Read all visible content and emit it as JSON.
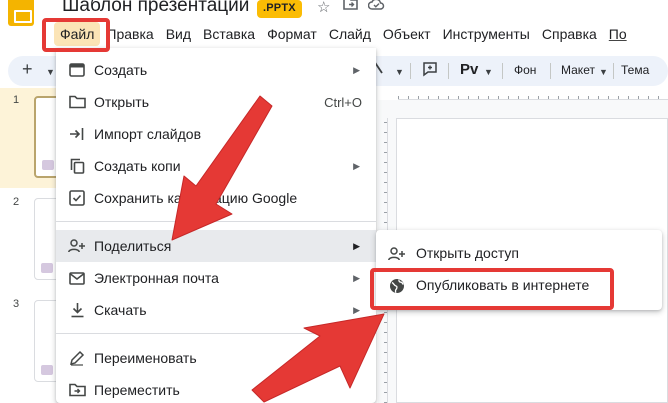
{
  "title_bar": {
    "doc_title": "Шаблон презентации",
    "badge": ".PPTX",
    "star_icon": "star-icon",
    "move_icon": "move-to-folder-icon",
    "cloud_icon": "cloud-status-icon"
  },
  "menu_bar": {
    "items": [
      "Файл",
      "Правка",
      "Вид",
      "Вставка",
      "Формат",
      "Слайд",
      "Объект",
      "Инструменты",
      "Справка",
      "По"
    ]
  },
  "toolbar": {
    "add": "+",
    "font_style": "Pv",
    "background": "Фон",
    "layout": "Макет",
    "theme": "Тема"
  },
  "slides": [
    "1",
    "2",
    "3"
  ],
  "file_menu": {
    "items": [
      {
        "label": "Создать",
        "icon": "new-presentation-icon",
        "submenu": true
      },
      {
        "label": "Открыть",
        "icon": "folder-icon",
        "shortcut": "Ctrl+O"
      },
      {
        "label": "Импорт слайдов",
        "icon": "import-icon"
      },
      {
        "label": "Создать копи",
        "icon": "copy-icon",
        "submenu": true
      },
      {
        "label": "Сохранить ка",
        "label_tail": "тацию Google",
        "icon": "save-google-icon"
      },
      {
        "label": "Поделиться",
        "icon": "share-person-icon",
        "submenu": true
      },
      {
        "label": "Электронная почта",
        "icon": "mail-icon",
        "submenu": true
      },
      {
        "label": "Скачать",
        "icon": "download-icon",
        "submenu": true
      },
      {
        "label": "Переименовать",
        "icon": "rename-icon"
      },
      {
        "label": "Переместить",
        "icon": "move-icon"
      }
    ]
  },
  "share_submenu": {
    "items": [
      {
        "label": "Открыть доступ",
        "icon": "add-person-icon"
      },
      {
        "label": "Опубликовать в интернете",
        "icon": "globe-icon"
      }
    ]
  },
  "colors": {
    "highlight": "#e53935",
    "menu_active": "#fbe4b6",
    "toolbar_bg": "#edf2fa",
    "badge_bg": "#fbbc04",
    "logo": "#f4b400"
  }
}
